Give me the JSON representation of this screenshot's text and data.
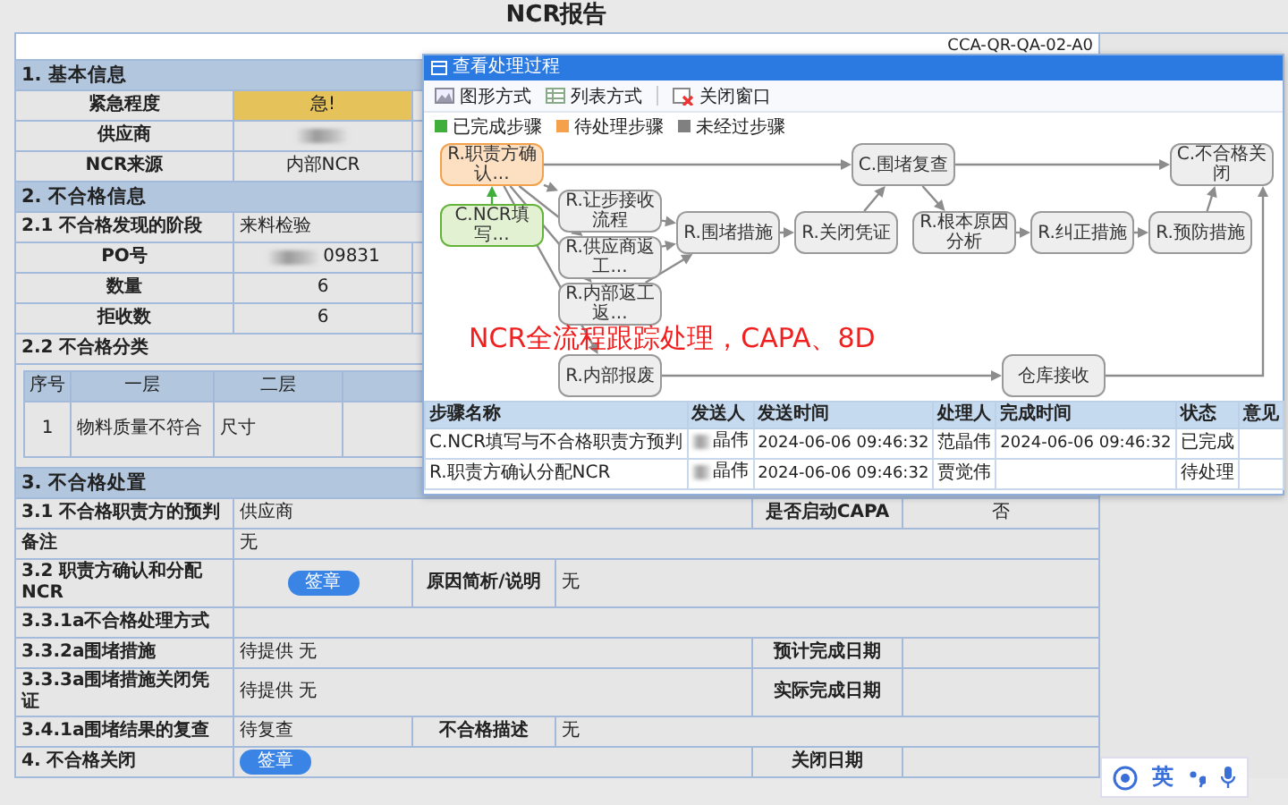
{
  "title": "NCR报告",
  "doc_code": "CCA-QR-QA-02-A0",
  "sections": [
    {
      "heading": "1. 基本信息",
      "rows": [
        {
          "kind": "pair",
          "label": "紧急程度",
          "value": "急!",
          "highlighted": true,
          "redacted": false
        },
        {
          "kind": "pair",
          "label": "供应商",
          "highlighted": false,
          "redacted": true
        },
        {
          "kind": "pair",
          "label": "NCR来源",
          "value": "内部NCR",
          "highlighted": false,
          "redacted": false
        }
      ]
    },
    {
      "heading": "2. 不合格信息",
      "rows": [
        {
          "kind": "pair_left",
          "label": "2.1 不合格发现的阶段",
          "value": "来料检验",
          "highlighted": false,
          "redacted": false
        },
        {
          "kind": "pair",
          "label": "PO号",
          "value": "09831",
          "highlighted": false,
          "redacted": true
        },
        {
          "kind": "pair",
          "label": "数量",
          "value": "6",
          "highlighted": false,
          "redacted": false
        },
        {
          "kind": "pair",
          "label": "拒收数",
          "value": "6",
          "highlighted": false,
          "redacted": false
        },
        {
          "kind": "subhead",
          "label": "2.2 不合格分类"
        },
        {
          "kind": "table",
          "columns": [
            "序号",
            "一层",
            "二层"
          ],
          "rows": [
            [
              "1",
              "物料质量不符合",
              "尺寸"
            ]
          ]
        }
      ]
    },
    {
      "heading": "3. 不合格处置",
      "rows": [
        {
          "kind": "quad_wide",
          "label": "3.1 不合格职责方的预判",
          "value": "供应商",
          "label2": "是否启动CAPA",
          "value2": "否"
        },
        {
          "kind": "pair_left",
          "label": "备注",
          "value": "无"
        },
        {
          "kind": "quad_narrow",
          "label": "3.2 职责方确认和分配NCR",
          "button": "签章",
          "label2": "原因简析/说明",
          "value2": "无"
        },
        {
          "kind": "pair_left",
          "label": "3.3.1a不合格处理方式"
        },
        {
          "kind": "quad_wide",
          "label": "3.3.2a围堵措施",
          "value": "待提供 无",
          "label2": "预计完成日期"
        },
        {
          "kind": "quad_wide",
          "label": "3.3.3a围堵措施关闭凭证",
          "value": "待提供 无",
          "label2": "实际完成日期"
        },
        {
          "kind": "quad_narrow",
          "label": "3.4.1a围堵结果的复查",
          "value": "待复查",
          "label2": "不合格描述",
          "value2": "无"
        },
        {
          "kind": "quad_wide",
          "label": "4. 不合格关闭",
          "button": "签章",
          "label2": "关闭日期"
        }
      ]
    }
  ],
  "dialog": {
    "title": "查看处理过程",
    "toolbar": [
      {
        "kind": "graph",
        "label": "图形方式"
      },
      {
        "kind": "list",
        "label": "列表方式"
      },
      {
        "kind": "close",
        "label": "关闭窗口"
      }
    ],
    "legend": [
      {
        "label": "已完成步骤",
        "color": "#3fae3a"
      },
      {
        "label": "待处理步骤",
        "color": "#f5a04a"
      },
      {
        "label": "未经过步骤",
        "color": "#808080"
      }
    ],
    "nodes": [
      {
        "label": "R.职责方确认...",
        "kind": "pending"
      },
      {
        "label": "C.NCR填写...",
        "kind": "done"
      },
      {
        "label": "R.让步接收流程",
        "kind": "idle"
      },
      {
        "label": "R.供应商返工...",
        "kind": "idle"
      },
      {
        "label": "R.内部返工返...",
        "kind": "idle"
      },
      {
        "label": "R.内部报废",
        "kind": "idle"
      },
      {
        "label": "R.围堵措施",
        "kind": "idle"
      },
      {
        "label": "R.关闭凭证",
        "kind": "idle"
      },
      {
        "label": "C.围堵复查",
        "kind": "idle"
      },
      {
        "label": "R.根本原因分析",
        "kind": "idle"
      },
      {
        "label": "R.纠正措施",
        "kind": "idle"
      },
      {
        "label": "R.预防措施",
        "kind": "idle"
      },
      {
        "label": "C.不合格关闭",
        "kind": "idle"
      },
      {
        "label": "仓库接收",
        "kind": "idle"
      }
    ],
    "table": {
      "columns": [
        "步骤名称",
        "发送人",
        "发送时间",
        "处理人",
        "完成时间",
        "状态",
        "意见"
      ],
      "rows": [
        {
          "step": "C.NCR填写与不合格职责方预判",
          "sender": "晶伟",
          "redacted": true,
          "sent": "2024-06-06 09:46:32",
          "handler": "范晶伟",
          "done": "2024-06-06 09:46:32",
          "status": "已完成"
        },
        {
          "step": "R.职责方确认分配NCR",
          "sender": "晶伟",
          "redacted": true,
          "sent": "2024-06-06 09:46:32",
          "handler": "贾觉伟",
          "status": "待处理"
        }
      ]
    }
  },
  "annotation": "NCR全流程跟踪处理，CAPA、8D",
  "ime": {
    "mode": "英"
  }
}
